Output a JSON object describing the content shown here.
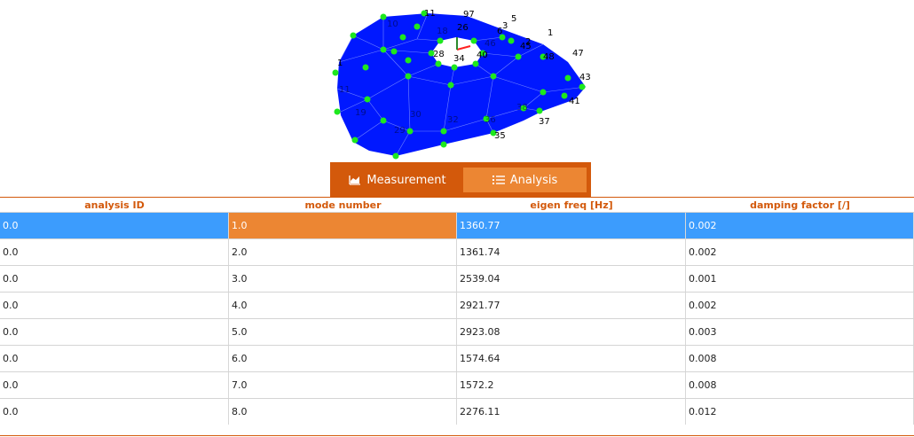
{
  "tabs": {
    "measurement": "Measurement",
    "analysis": "Analysis",
    "active": "Analysis"
  },
  "mesh": {
    "colors": {
      "surface": "#0018ff",
      "node": "#1ee81e",
      "axis_x": "#ff2020",
      "axis_y": "#2c8a2c"
    },
    "node_labels": [
      "11",
      "97",
      "3",
      "5",
      "6",
      "1",
      "2",
      "15",
      "45",
      "48",
      "47",
      "43",
      "41",
      "37",
      "35",
      "28",
      "34",
      "40",
      "26",
      "1"
    ]
  },
  "table": {
    "columns": [
      "analysis ID",
      "mode number",
      "eigen freq [Hz]",
      "damping factor [/]"
    ],
    "selected_row": 0,
    "rows": [
      [
        "0.0",
        "1.0",
        "1360.77",
        "0.002"
      ],
      [
        "0.0",
        "2.0",
        "1361.74",
        "0.002"
      ],
      [
        "0.0",
        "3.0",
        "2539.04",
        "0.001"
      ],
      [
        "0.0",
        "4.0",
        "2921.77",
        "0.002"
      ],
      [
        "0.0",
        "5.0",
        "2923.08",
        "0.003"
      ],
      [
        "0.0",
        "6.0",
        "1574.64",
        "0.008"
      ],
      [
        "0.0",
        "7.0",
        "1572.2",
        "0.008"
      ],
      [
        "0.0",
        "8.0",
        "2276.11",
        "0.012"
      ]
    ]
  }
}
